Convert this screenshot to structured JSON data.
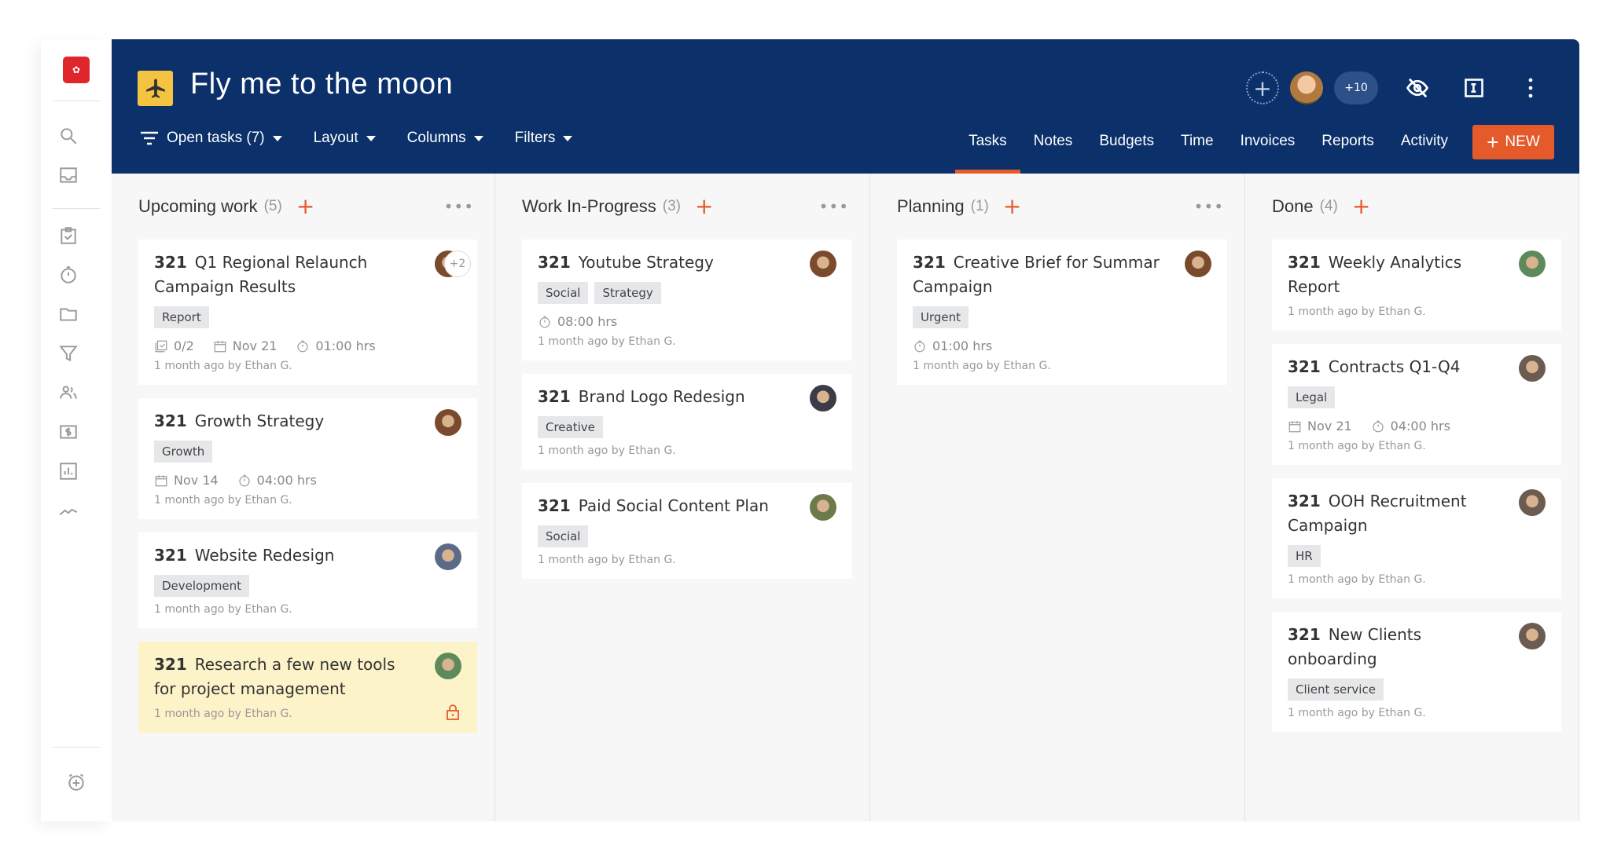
{
  "project": {
    "title": "Fly me to the moon",
    "icon": "airplane-icon",
    "icon_color": "#f5c342"
  },
  "colors": {
    "header": "#0b306a",
    "accent": "#e55a2b",
    "board": "#f7f7f7",
    "highlight": "#fdf3c9"
  },
  "header": {
    "members_more": "+10",
    "new_label": "NEW"
  },
  "toolbar": [
    {
      "label": "Open tasks (7)"
    },
    {
      "label": "Layout"
    },
    {
      "label": "Columns"
    },
    {
      "label": "Filters"
    }
  ],
  "tabs": [
    {
      "label": "Tasks",
      "active": true
    },
    {
      "label": "Notes"
    },
    {
      "label": "Budgets"
    },
    {
      "label": "Time"
    },
    {
      "label": "Invoices"
    },
    {
      "label": "Reports"
    },
    {
      "label": "Activity"
    }
  ],
  "sidebar": [
    "search-icon",
    "inbox-icon",
    "tasks-icon",
    "timer-icon",
    "folder-icon",
    "filter-icon",
    "people-icon",
    "dollar-icon",
    "report-chart-icon",
    "trend-icon"
  ],
  "columns": [
    {
      "name": "Upcoming work",
      "count": "(5)",
      "cards": [
        {
          "id": "321",
          "title": "Q1 Regional Relaunch Campaign Results",
          "tags": [
            "Report"
          ],
          "checklist": "0/2",
          "date": "Nov 21",
          "time": "01:00 hrs",
          "footer": "1 month ago by Ethan G.",
          "avatar": "#7a4a2c",
          "extra": "+2"
        },
        {
          "id": "321",
          "title": "Growth Strategy",
          "tags": [
            "Growth"
          ],
          "date": "Nov 14",
          "time": "04:00 hrs",
          "footer": "1 month ago by Ethan G.",
          "avatar": "#7a4a2c"
        },
        {
          "id": "321",
          "title": "Website Redesign",
          "tags": [
            "Development"
          ],
          "footer": "1 month ago by Ethan G.",
          "avatar": "#5b6a86"
        },
        {
          "id": "321",
          "title": "Research a few new tools for project management",
          "tags": [],
          "footer": "1 month ago by Ethan G.",
          "avatar": "#5d8a5a",
          "highlighted": true,
          "locked": true
        }
      ]
    },
    {
      "name": "Work In-Progress",
      "count": "(3)",
      "cards": [
        {
          "id": "321",
          "title": "Youtube Strategy",
          "tags": [
            "Social",
            "Strategy"
          ],
          "time": "08:00 hrs",
          "footer": "1 month ago by Ethan G.",
          "avatar": "#7a4a2c"
        },
        {
          "id": "321",
          "title": "Brand Logo Redesign",
          "tags": [
            "Creative"
          ],
          "footer": "1 month ago by Ethan G.",
          "avatar": "#3a3d48"
        },
        {
          "id": "321",
          "title": "Paid Social Content Plan",
          "tags": [
            "Social"
          ],
          "footer": "1 month ago by Ethan G.",
          "avatar": "#6d7a4a"
        }
      ]
    },
    {
      "name": "Planning",
      "count": "(1)",
      "cards": [
        {
          "id": "321",
          "title": "Creative Brief for Summar Campaign",
          "tags": [
            "Urgent"
          ],
          "time": "01:00 hrs",
          "footer": "1 month ago by Ethan G.",
          "avatar": "#7a4a2c"
        }
      ]
    },
    {
      "name": "Done",
      "count": "(4)",
      "cards": [
        {
          "id": "321",
          "title": "Weekly Analytics Report",
          "tags": [],
          "footer": "1 month ago by Ethan G.",
          "avatar": "#5d8a5a"
        },
        {
          "id": "321",
          "title": "Contracts Q1-Q4",
          "tags": [
            "Legal"
          ],
          "date": "Nov 21",
          "time": "04:00 hrs",
          "footer": "1 month ago by Ethan G.",
          "avatar": "#6b5b50"
        },
        {
          "id": "321",
          "title": "OOH Recruitment Campaign",
          "tags": [
            "HR"
          ],
          "footer": "1 month ago by Ethan G.",
          "avatar": "#6b5b50"
        },
        {
          "id": "321",
          "title": "New Clients onboarding",
          "tags": [
            "Client service"
          ],
          "footer": "1 month ago by Ethan G.",
          "avatar": "#6b5b50"
        }
      ]
    }
  ]
}
